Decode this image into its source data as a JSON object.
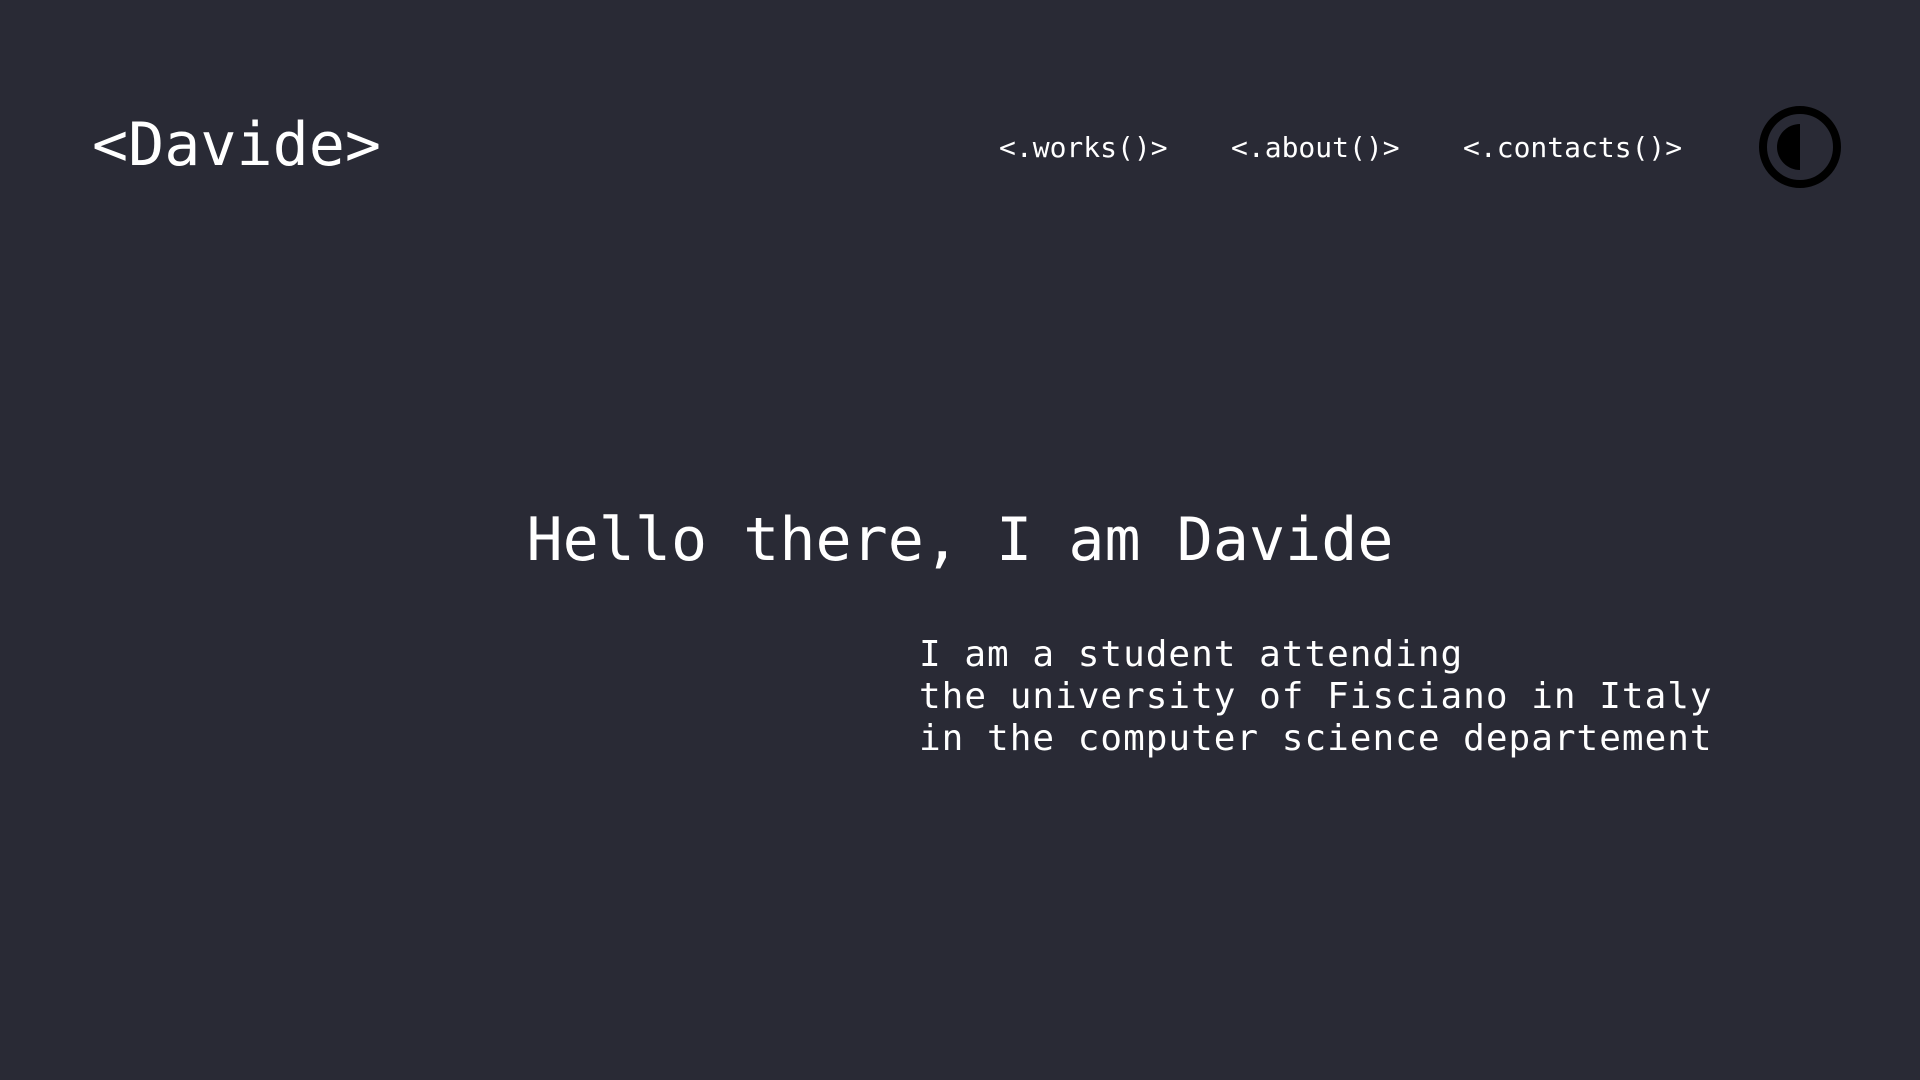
{
  "header": {
    "logo": "<Davide>",
    "nav": [
      {
        "label": "<.works()>"
      },
      {
        "label": "<.about()>"
      },
      {
        "label": "<.contacts()>"
      }
    ],
    "theme_toggle_icon": "contrast-icon"
  },
  "hero": {
    "title": "Hello there, I am Davide",
    "description_lines": [
      "I am a student attending",
      "the university of Fisciano in Italy",
      "in the computer science departement"
    ]
  },
  "colors": {
    "background": "#292a35",
    "text": "#ffffff",
    "icon": "#000000"
  }
}
